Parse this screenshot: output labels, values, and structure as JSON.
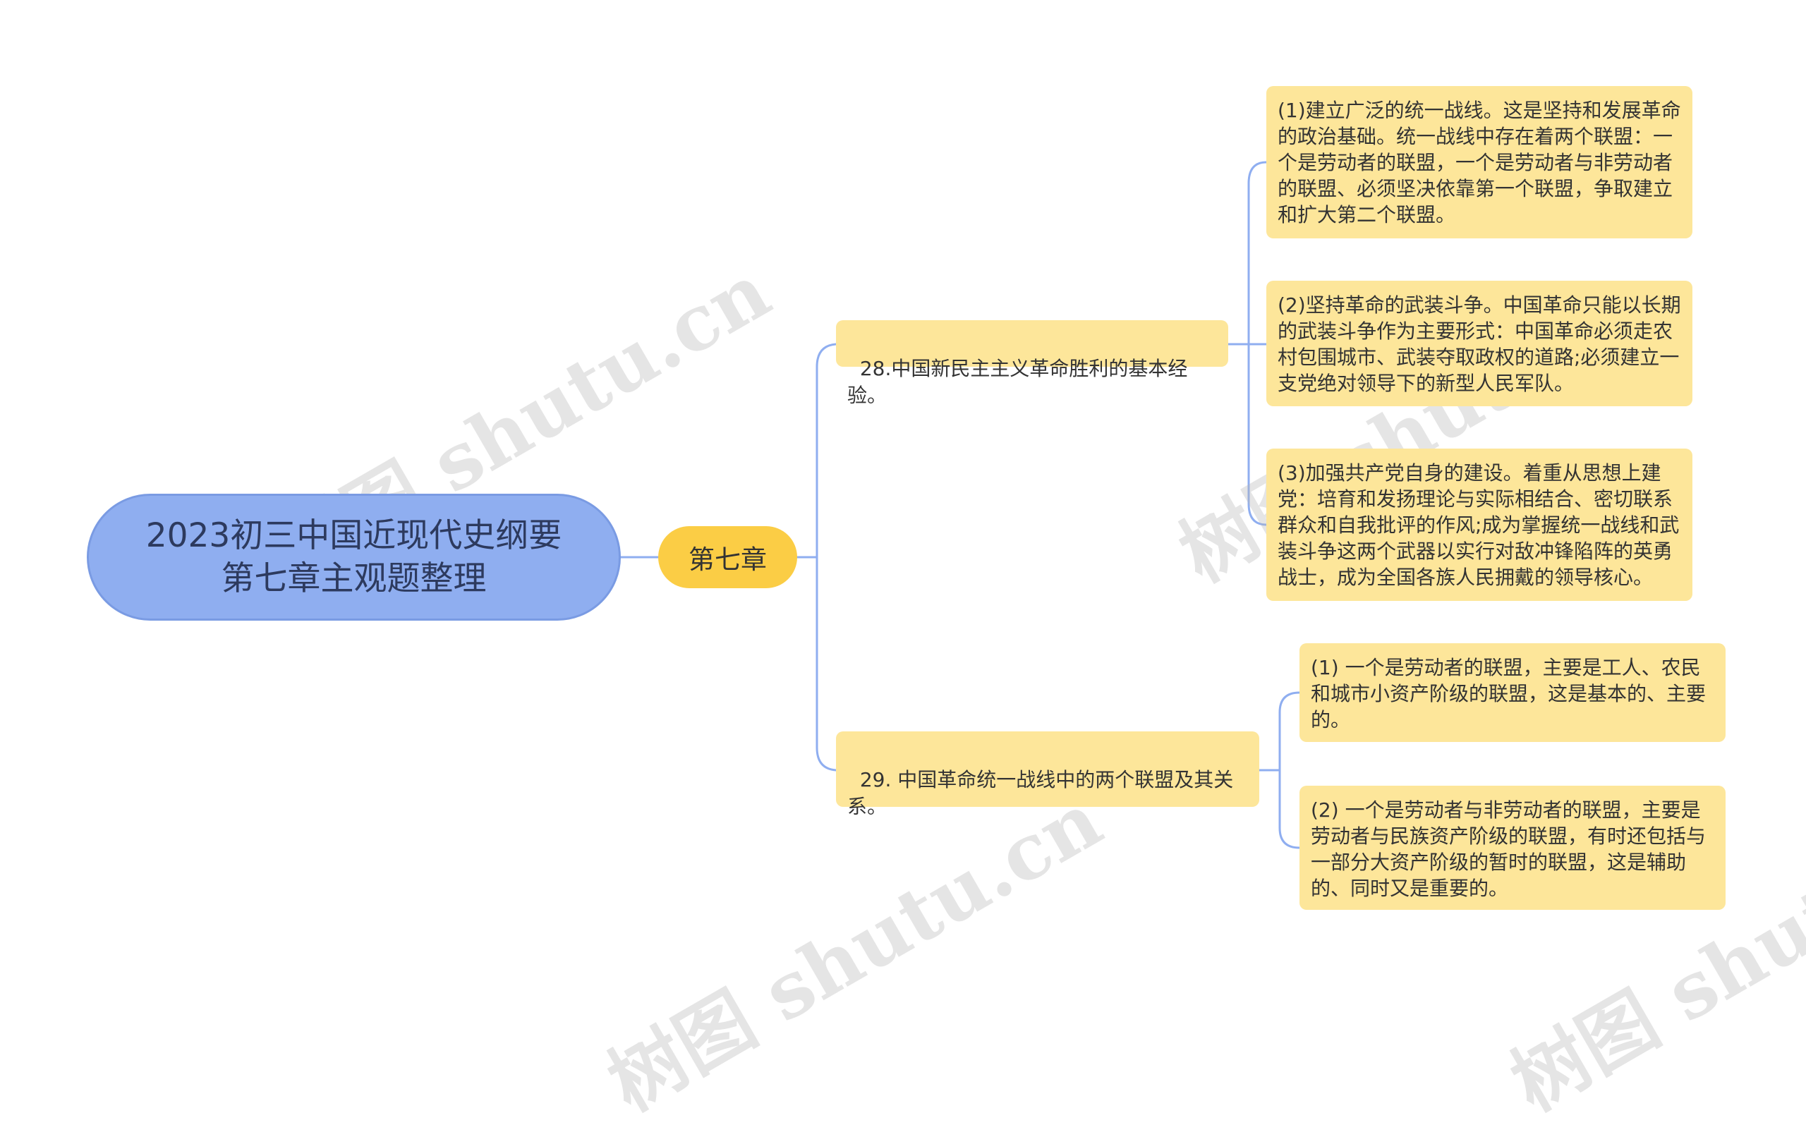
{
  "root": {
    "title": "2023初三中国近现代史纲要第七章主观题整理"
  },
  "branch": {
    "label": "第七章"
  },
  "topics": [
    {
      "label": "28.中国新民主主义革命胜利的基本经验。",
      "items": [
        "(1)建立广泛的统一战线。这是坚持和发展革命的政治基础。统一战线中存在着两个联盟：一个是劳动者的联盟，一个是劳动者与非劳动者的联盟、必须坚决依靠第一个联盟，争取建立和扩大第二个联盟。",
        "(2)坚持革命的武装斗争。中国革命只能以长期的武装斗争作为主要形式：中国革命必须走农村包围城市、武装夺取政权的道路;必须建立一支党绝对领导下的新型人民军队。",
        "(3)加强共产党自身的建设。着重从思想上建党：培育和发扬理论与实际相结合、密切联系群众和自我批评的作风;成为掌握统一战线和武装斗争这两个武器以实行对敌冲锋陷阵的英勇战士，成为全国各族人民拥戴的领导核心。"
      ]
    },
    {
      "label": "29. 中国革命统一战线中的两个联盟及其关系。",
      "items": [
        "(1) 一个是劳动者的联盟，主要是工人、农民和城市小资产阶级的联盟，这是基本的、主要的。",
        "(2) 一个是劳动者与非劳动者的联盟，主要是劳动者与民族资产阶级的联盟，有时还包括与一部分大资产阶级的暂时的联盟，这是辅助的、同时又是重要的。"
      ]
    }
  ],
  "watermark": "树图 shutu.cn",
  "colors": {
    "root_fill": "#8faef0",
    "branch_fill": "#fbcd45",
    "topic_fill": "#fde69a",
    "connector": "#8faef0"
  }
}
